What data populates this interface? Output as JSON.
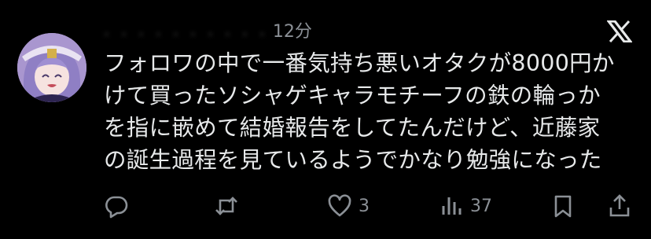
{
  "tweet": {
    "header": {
      "handle_blurred": ".  .  .  .  .  .  .  . .  .",
      "time": "12分"
    },
    "text_lines": [
      "フォロワの中で一番気持ち悪いオタクが8000円か",
      "けて買ったソシャゲキャラモチーフの鉄の輪っか",
      "を指に嵌めて結婚報告をしてたんだけど、近藤家",
      "の誕生過程を見ているようでかなり勉強になった"
    ],
    "actions": {
      "reply_count": "",
      "retweet_count": "",
      "like_count": "3",
      "views_count": "37"
    },
    "icons": {
      "logo": "x-logo-icon",
      "reply": "reply-icon",
      "retweet": "retweet-icon",
      "like": "heart-icon",
      "views": "views-icon",
      "bookmark": "bookmark-icon",
      "share": "share-icon"
    }
  }
}
